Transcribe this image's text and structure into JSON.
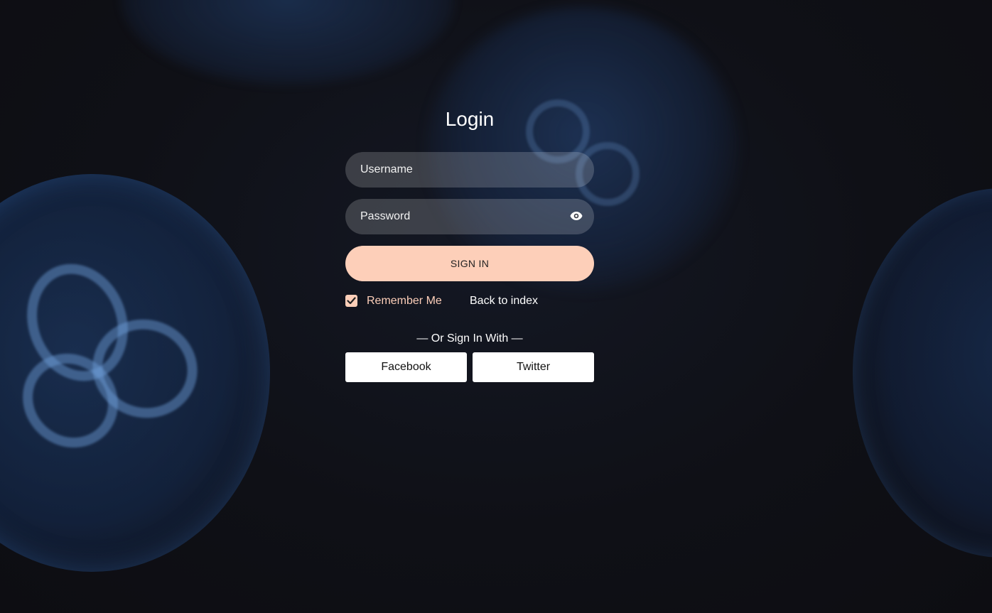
{
  "login": {
    "title": "Login",
    "username_placeholder": "Username",
    "password_placeholder": "Password",
    "password_toggle_icon": "eye-icon",
    "signin_label": "SIGN IN",
    "remember_label": "Remember Me",
    "remember_checked": true,
    "back_link": "Back to index",
    "divider_text": "— Or Sign In With —",
    "facebook_label": "Facebook",
    "twitter_label": "Twitter"
  },
  "colors": {
    "accent": "#fdcfb9",
    "background": "#0f0f15",
    "field_background": "rgba(255,255,255,0.18)"
  }
}
